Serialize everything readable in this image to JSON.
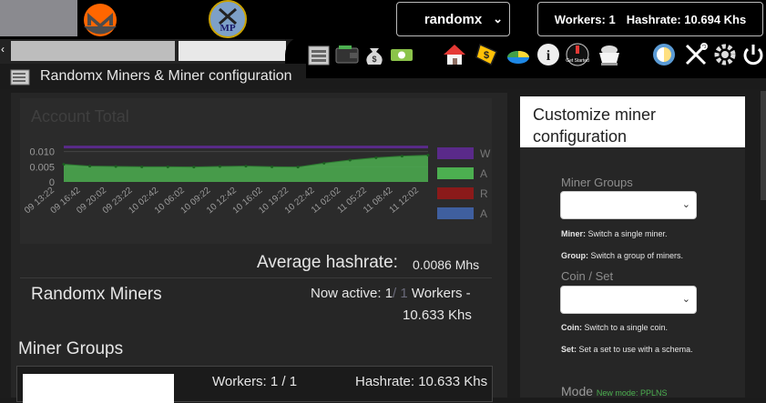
{
  "header": {
    "algo_select": "randomx",
    "workers_label": "Workers: 1",
    "hashrate_label": "Hashrate: 10.694 Khs"
  },
  "icons": [
    "miner-icon",
    "wallet-icon",
    "money-bag-icon",
    "cash-icon",
    "home-icon",
    "coin-tag-icon",
    "pie-chart-icon",
    "info-icon",
    "get-started-icon",
    "mining-cart-icon",
    "theme-toggle-icon",
    "tools-icon",
    "settings-icon",
    "power-icon"
  ],
  "page_title": "Randomx Miners & Miner configuration",
  "chart": {
    "title": "Account Total",
    "y_ticks": [
      "0.010",
      "0.005",
      "0"
    ],
    "x_ticks": [
      "09 13:22",
      "09 16:42",
      "09 20:02",
      "09 23:22",
      "10 02:42",
      "10 06:02",
      "10 09:22",
      "10 12:42",
      "10 16:02",
      "10 19:22",
      "10 22:42",
      "11 02:02",
      "11 05:22",
      "11 08:42",
      "11 12:02"
    ],
    "legend": [
      "W",
      "A",
      "R",
      "A"
    ],
    "colors": {
      "purple": "#5a2a8a",
      "green": "#4caf50",
      "red": "#8b1a1a",
      "blue": "#3f5f9f"
    }
  },
  "chart_data": {
    "type": "area",
    "x": [
      "09 13:22",
      "09 16:42",
      "09 20:02",
      "09 23:22",
      "10 02:42",
      "10 06:02",
      "10 09:22",
      "10 12:42",
      "10 16:02",
      "10 19:22",
      "10 22:42",
      "11 02:02",
      "11 05:22",
      "11 08:42",
      "11 12:02"
    ],
    "series": [
      {
        "name": "W",
        "values": [
          0.0115,
          0.0115,
          0.0115,
          0.0115,
          0.0115,
          0.0115,
          0.0115,
          0.0115,
          0.0115,
          0.0115,
          0.0115,
          0.0115,
          0.0115,
          0.0115,
          0.0115
        ]
      },
      {
        "name": "A",
        "values": [
          0.0058,
          0.0052,
          0.0051,
          0.005,
          0.005,
          0.0049,
          0.0051,
          0.0052,
          0.005,
          0.0049,
          0.0062,
          0.0072,
          0.008,
          0.0085,
          0.0088
        ]
      }
    ],
    "ylim": [
      0,
      0.012
    ]
  },
  "average": {
    "label": "Average hashrate:",
    "value": "0.0086 Mhs"
  },
  "miners": {
    "title": "Randomx Miners",
    "now_active": "Now active: 1",
    "now_active_total": "/ 1",
    "workers_suffix": "Workers -",
    "khs": "10.633 Khs"
  },
  "groups": {
    "title": "Miner Groups",
    "row_workers": "Workers: 1 / 1",
    "row_hashrate": "Hashrate: 10.633 Khs"
  },
  "customize": {
    "title": "Customize miner configuration",
    "miner_groups_label": "Miner Groups",
    "note_miner_b": "Miner:",
    "note_miner": " Switch a single miner.",
    "note_group_b": "Group:",
    "note_group": " Switch a group of miners.",
    "coin_set_label": "Coin / Set",
    "note_coin_b": "Coin:",
    "note_coin": " Switch to a single coin.",
    "note_set_b": "Set:",
    "note_set": " Set a set to use with a schema.",
    "mode_label": "Mode",
    "mode_value": "New mode: PPLNS"
  }
}
